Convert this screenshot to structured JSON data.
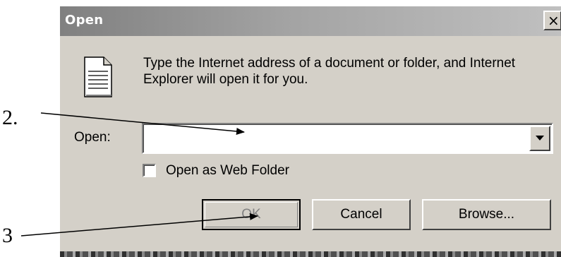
{
  "dialog": {
    "title": "Open",
    "close_glyph": "×",
    "icon": "document-icon",
    "message": "Type the Internet address of a document or folder, and Internet Explorer will open it for you.",
    "open_label": "Open:",
    "address_value": "",
    "checkbox": {
      "label": "Open as Web Folder",
      "checked": false
    },
    "buttons": {
      "ok": "OK",
      "cancel": "Cancel",
      "browse": "Browse..."
    }
  },
  "annotations": {
    "step_2": "2.",
    "step_3": "3"
  },
  "colors": {
    "dialog_face": "#d4d0c8",
    "titlebar_start": "#808080",
    "titlebar_end": "#c0c0c0",
    "annotation": "#000000"
  }
}
